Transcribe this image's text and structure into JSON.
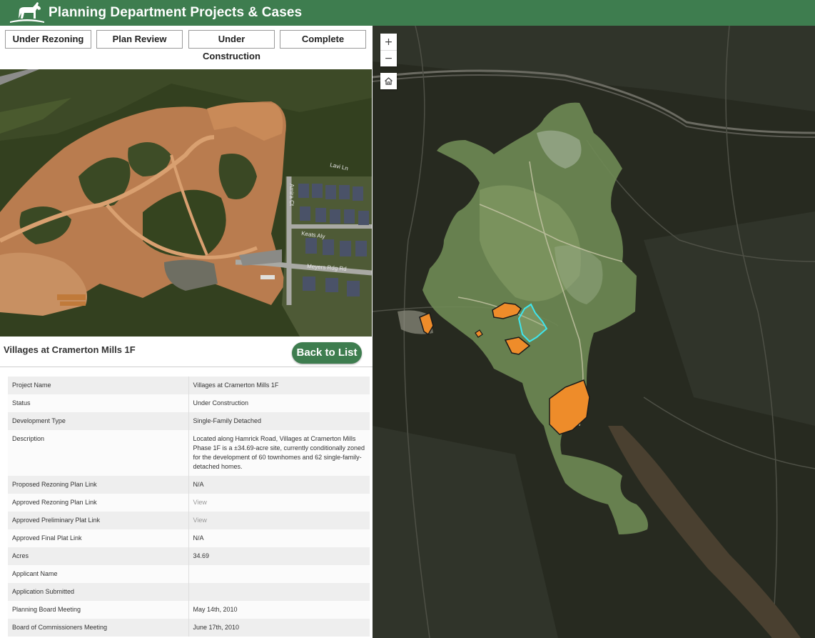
{
  "header": {
    "title": "Planning Department Projects & Cases",
    "logo_icon": "goat-logo-icon"
  },
  "filters": [
    {
      "label": "Under Rezoning"
    },
    {
      "label": "Plan Review"
    },
    {
      "label": "Under Construction"
    },
    {
      "label": "Complete"
    }
  ],
  "photo": {
    "street_labels": [
      "Lavi Ln",
      "Keats Aly",
      "Meyers Rdg Rd",
      "Amira Ct"
    ]
  },
  "project": {
    "title": "Villages at Cramerton Mills 1F",
    "back_label": "Back to List"
  },
  "details": [
    {
      "label": "Project Name",
      "value": "Villages at Cramerton Mills 1F",
      "link": false
    },
    {
      "label": "Status",
      "value": "Under Construction",
      "link": false
    },
    {
      "label": "Development Type",
      "value": "Single-Family Detached",
      "link": false
    },
    {
      "label": "Description",
      "value": "Located along Hamrick Road, Villages at Cramerton Mills Phase 1F is a ±34.69-acre site, currently conditionally zoned for the development of 60 townhomes and 62 single-family-detached homes.",
      "link": false
    },
    {
      "label": "Proposed Rezoning Plan Link",
      "value": "N/A",
      "link": false
    },
    {
      "label": "Approved Rezoning Plan Link",
      "value": "View",
      "link": true
    },
    {
      "label": "Approved Preliminary Plat Link",
      "value": "View",
      "link": true
    },
    {
      "label": "Approved Final Plat Link",
      "value": "N/A",
      "link": false
    },
    {
      "label": "Acres",
      "value": "34.69",
      "link": false
    },
    {
      "label": "Applicant Name",
      "value": "",
      "link": false
    },
    {
      "label": "Application Submitted",
      "value": "",
      "link": false
    },
    {
      "label": "Planning Board Meeting",
      "value": "May 14th, 2010",
      "link": false
    },
    {
      "label": "Board of Commissioners Meeting",
      "value": "June 17th, 2010",
      "link": false
    }
  ],
  "map": {
    "zoom_in": "+",
    "zoom_out": "−",
    "home_icon": "home-icon",
    "colors": {
      "parcel_fill": "#ee8c2a",
      "selected_outline": "#3ee6ee",
      "boundary_fill": "#7a9a5c"
    }
  }
}
